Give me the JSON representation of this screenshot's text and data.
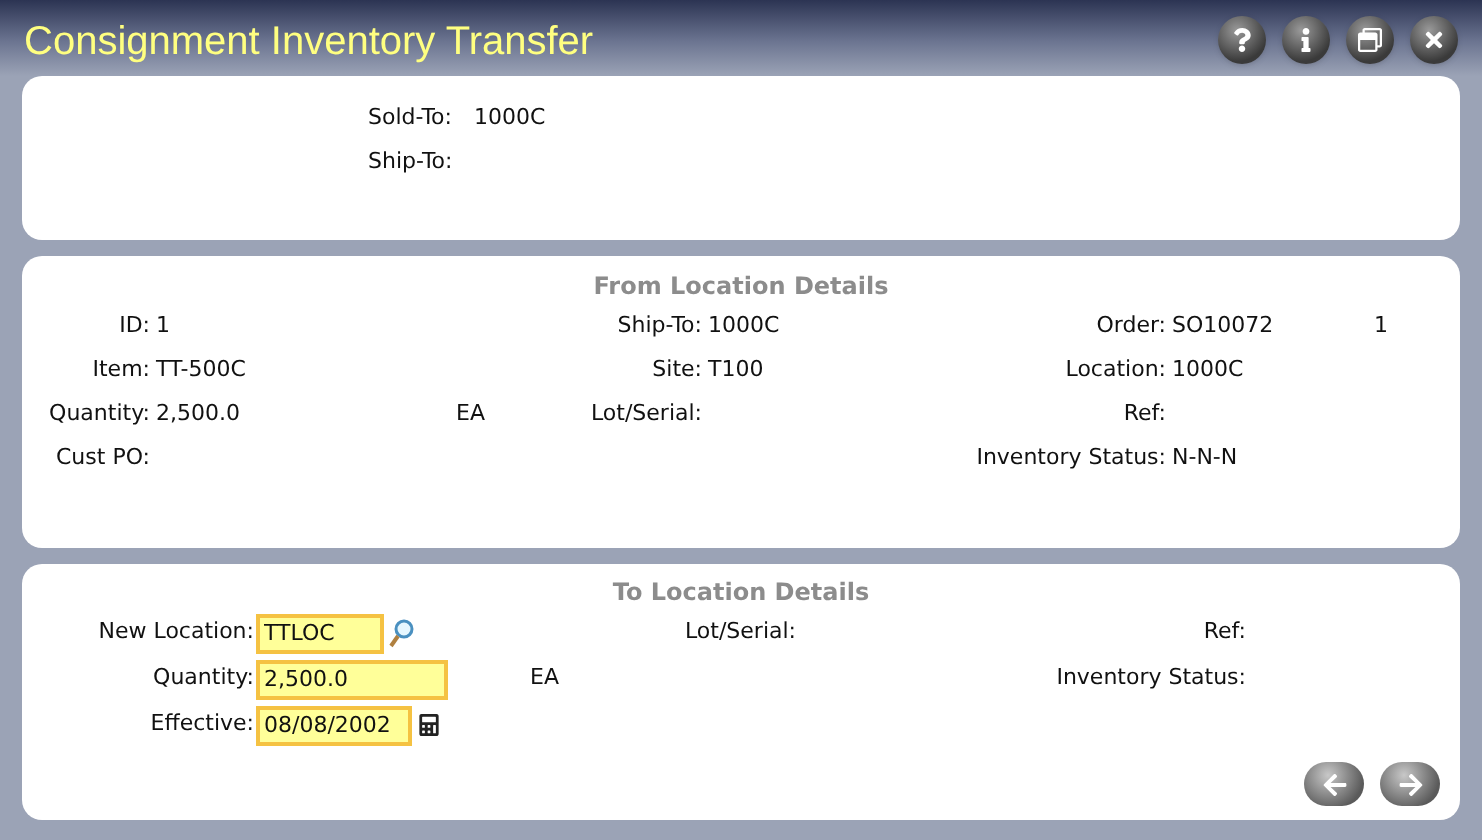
{
  "window": {
    "title": "Consignment Inventory Transfer"
  },
  "header": {
    "fields": [
      {
        "label": "Sold-To:",
        "value": "1000C"
      },
      {
        "label": "Ship-To:"
      }
    ]
  },
  "from_location": {
    "title": "From Location Details",
    "columns": [
      [
        {
          "label": "ID:",
          "value": "1"
        },
        {
          "label": "Item:",
          "value": "TT-500C"
        },
        {
          "label": "Quantity:",
          "value": "2,500.0",
          "unit": "EA"
        },
        {
          "label": "Cust PO:"
        }
      ],
      [
        {
          "label": "Ship-To:",
          "value": "1000C"
        },
        {
          "label": "Site:",
          "value": "T100"
        },
        {
          "label": "Lot/Serial:"
        }
      ],
      [
        {
          "label": "Order:",
          "value": "SO10072",
          "extra": "1"
        },
        {
          "label": "Location:",
          "value": "1000C"
        },
        {
          "label": "Ref:"
        },
        {
          "label": "Inventory Status:",
          "value": "N-N-N"
        }
      ]
    ]
  },
  "to_location": {
    "title": "To Location Details",
    "columns": [
      [
        {
          "label": "New Location:",
          "kind": "lookup-input",
          "value": "TTLOC"
        },
        {
          "label": "Quantity:",
          "kind": "input",
          "value": "2,500.0",
          "unit": "EA"
        },
        {
          "label": "Effective:",
          "kind": "date-input",
          "value": "08/08/2002"
        }
      ],
      [
        {
          "label": "Lot/Serial:",
          "kind": "text"
        }
      ],
      [
        {
          "label": "Ref:",
          "kind": "text"
        },
        {
          "label": "Inventory Status:",
          "kind": "text"
        }
      ]
    ]
  }
}
